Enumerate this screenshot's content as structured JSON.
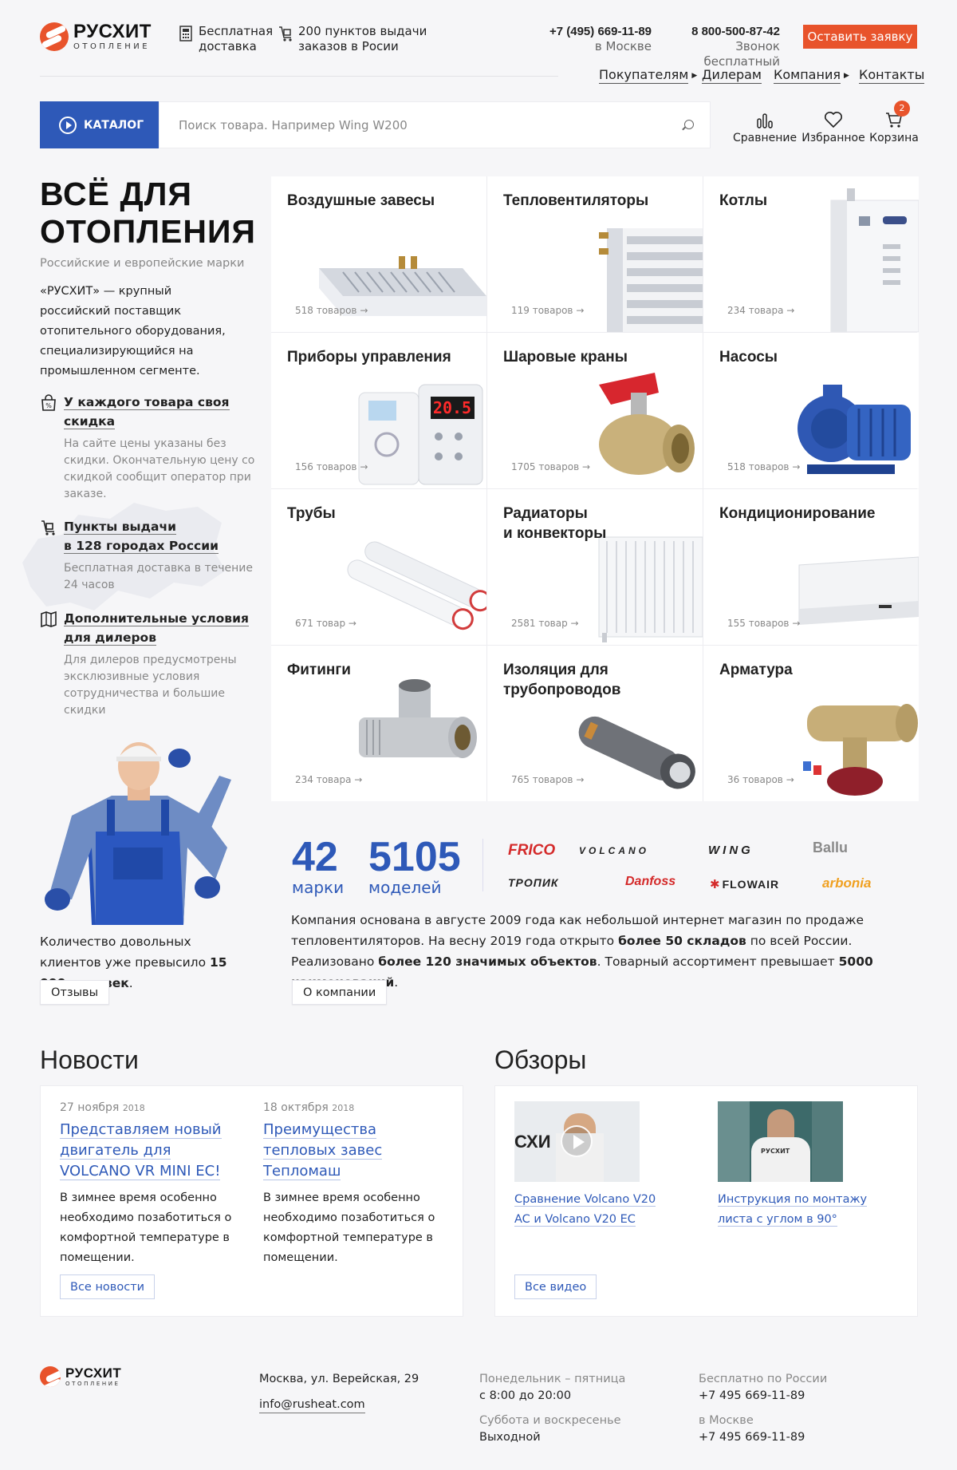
{
  "header": {
    "logo_name": "РУСХИТ",
    "logo_sub": "ОТОПЛЕНИЕ",
    "delivery": [
      "Бесплатная",
      "доставка"
    ],
    "pickup": [
      "200 пунктов выдачи",
      "заказов в Росии"
    ],
    "phone_moscow": "+7 (495) 669-11-89",
    "phone_moscow_note": "в Москве",
    "phone_free": "8 800-500-87-42",
    "phone_free_note": "Звонок бесплатный",
    "request_button": "Оставить заявку",
    "nav": [
      "Покупателям",
      "Дилерам",
      "Компания",
      "Контакты"
    ]
  },
  "search": {
    "catalog_label": "КАТАЛОГ",
    "placeholder": "Поиск товара. Например Wing W200"
  },
  "tools": {
    "compare": "Сравнение",
    "favorites": "Избранное",
    "cart": "Корзина",
    "cart_count": "2"
  },
  "intro": {
    "title_1": "ВСЁ ДЛЯ",
    "title_2": "ОТОПЛЕНИЯ",
    "subtitle": "Российские и европейские марки",
    "text": "«РУСХИТ» — крупный российский поставщик отопительного оборудования, специализирующийся на промышленном сегменте."
  },
  "features": [
    {
      "title_1": "У каждого товара своя",
      "title_2": "скидка",
      "text": "На сайте цены указаны без скидки. Окончательную цену со скидкой сообщит оператор при заказе."
    },
    {
      "title_1": "Пункты выдачи",
      "title_2": "в 128 городах России",
      "text": "Бесплатная доставка в течение 24 часов"
    },
    {
      "title_1": "Дополнительные условия",
      "title_2": "для дилеров",
      "text": "Для дилеров предусмотрены эксклюзивные условия сотрудничества и большие скидки"
    }
  ],
  "categories": [
    {
      "title": "Воздушные завесы",
      "count": "518 товаров →"
    },
    {
      "title": "Тепловентиляторы",
      "count": "119 товаров →"
    },
    {
      "title": "Котлы",
      "count": "234 товара →"
    },
    {
      "title": "Приборы управления",
      "count": "156 товаров →"
    },
    {
      "title": "Шаровые краны",
      "count": "1705 товаров →"
    },
    {
      "title": "Насосы",
      "count": "518 товаров →"
    },
    {
      "title": "Трубы",
      "count": "671 товар →"
    },
    {
      "title": "Радиаторы\nи конвекторы",
      "count": "2581 товар →"
    },
    {
      "title": "Кондиционирование",
      "count": "155 товаров →"
    },
    {
      "title": "Фитинги",
      "count": "234 товара →"
    },
    {
      "title": "Изоляция для\nтрубопроводов",
      "count": "765 товаров →"
    },
    {
      "title": "Арматура",
      "count": "36 товаров →"
    }
  ],
  "clients": {
    "text_1": "Количество довольных клиентов",
    "text_2": "уже превысило",
    "highlight": "15 000 человек",
    "dot": ".",
    "button": "Отзывы"
  },
  "stats": {
    "brands_num": "42",
    "brands_label": "марки",
    "models_num": "5105",
    "models_label": "моделей"
  },
  "brands": [
    "FRICO",
    "VOLCANO",
    "WING",
    "Ballu",
    "ТРОПИК",
    "Danfoss",
    "FLOWAIR",
    "arbonia"
  ],
  "about": {
    "t1": "Компания основана в августе 2009 года как небольшой интернет магазин по продаже тепловентиляторов. На весну 2019 года открыто ",
    "b1": "более 50 складов",
    "t2": " по всей России. Реализовано ",
    "b2": "более 120 значимых объектов",
    "t3": ". Товарный ассортимент превышает ",
    "b3": "5000 наименований",
    "t4": ".",
    "button": "О компании"
  },
  "news": {
    "heading": "Новости",
    "items": [
      {
        "date": "27 ноября",
        "year": "2018",
        "title": "Представляем новый двигатель для VOLCANO VR MINI EC!",
        "text": "В зимнее время особенно необходимо позаботиться о комфортной температуре в помещении."
      },
      {
        "date": "18 октября",
        "year": "2018",
        "title": "Преимущества тепловых завес Тепломаш",
        "text": "В зимнее время особенно необходимо позаботиться о комфортной температуре в помещении."
      }
    ],
    "all_button": "Все новости"
  },
  "reviews": {
    "heading": "Обзоры",
    "items": [
      {
        "title": "Сравнение Volcano V20 AC и Volcano V20 EC",
        "thumb_text": "СХИ"
      },
      {
        "title": "Инструкция по монтажу листа с углом в 90°",
        "thumb_text": "РУСХИТ"
      }
    ],
    "all_button": "Все видео"
  },
  "footer": {
    "address": "Москва, ул. Верейская, 29",
    "email": "info@rusheat.com",
    "weekdays_label": "Понедельник – пятница",
    "weekdays_hours": "с 8:00 до 20:00",
    "weekend_label": "Суббота и воскресенье",
    "weekend_hours": "Выходной",
    "free_label": "Бесплатно по России",
    "free_phone": "+7 495 669-11-89",
    "moscow_label": "в Москве",
    "moscow_phone": "+7 495 669-11-89"
  },
  "colors": {
    "accent": "#2e59b8",
    "brand": "#e8532b"
  }
}
